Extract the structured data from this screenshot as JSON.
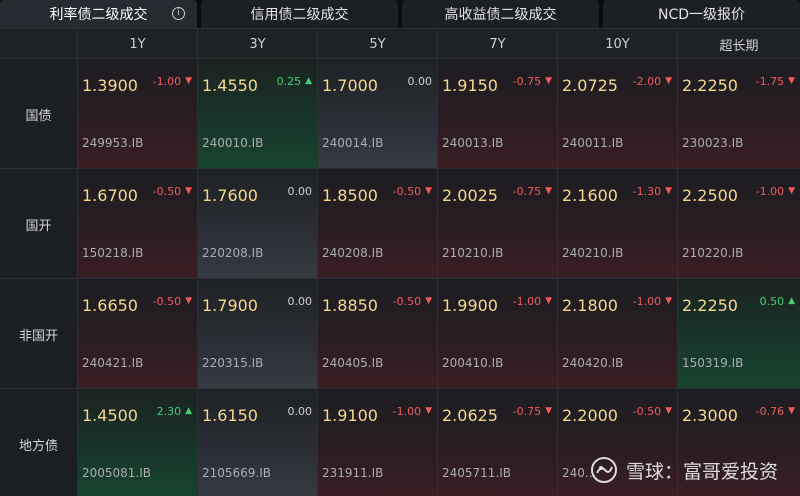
{
  "tabs": [
    {
      "label": "利率债二级成交",
      "active": true,
      "icon": "info-icon"
    },
    {
      "label": "信用债二级成交",
      "active": false
    },
    {
      "label": "高收益债二级成交",
      "active": false
    },
    {
      "label": "NCD一级报价",
      "active": false
    }
  ],
  "info_icon_glyph": "i",
  "columns": [
    "1Y",
    "3Y",
    "5Y",
    "7Y",
    "10Y",
    "超长期"
  ],
  "rows": [
    {
      "label": "国债",
      "cells": [
        {
          "price": "1.3900",
          "change": "-1.00",
          "direction": "down",
          "code": "249953.IB"
        },
        {
          "price": "1.4550",
          "change": "0.25",
          "direction": "up",
          "code": "240010.IB"
        },
        {
          "price": "1.7000",
          "change": "0.00",
          "direction": "flat",
          "code": "240014.IB"
        },
        {
          "price": "1.9150",
          "change": "-0.75",
          "direction": "down",
          "code": "240013.IB"
        },
        {
          "price": "2.0725",
          "change": "-2.00",
          "direction": "down",
          "code": "240011.IB"
        },
        {
          "price": "2.2250",
          "change": "-1.75",
          "direction": "down",
          "code": "230023.IB"
        }
      ]
    },
    {
      "label": "国开",
      "cells": [
        {
          "price": "1.6700",
          "change": "-0.50",
          "direction": "down",
          "code": "150218.IB"
        },
        {
          "price": "1.7600",
          "change": "0.00",
          "direction": "flat",
          "code": "220208.IB"
        },
        {
          "price": "1.8500",
          "change": "-0.50",
          "direction": "down",
          "code": "240208.IB"
        },
        {
          "price": "2.0025",
          "change": "-0.75",
          "direction": "down",
          "code": "210210.IB"
        },
        {
          "price": "2.1600",
          "change": "-1.30",
          "direction": "down",
          "code": "240210.IB"
        },
        {
          "price": "2.2500",
          "change": "-1.00",
          "direction": "down",
          "code": "210220.IB"
        }
      ]
    },
    {
      "label": "非国开",
      "cells": [
        {
          "price": "1.6650",
          "change": "-0.50",
          "direction": "down",
          "code": "240421.IB"
        },
        {
          "price": "1.7900",
          "change": "0.00",
          "direction": "flat",
          "code": "220315.IB"
        },
        {
          "price": "1.8850",
          "change": "-0.50",
          "direction": "down",
          "code": "240405.IB"
        },
        {
          "price": "1.9900",
          "change": "-1.00",
          "direction": "down",
          "code": "200410.IB"
        },
        {
          "price": "2.1800",
          "change": "-1.00",
          "direction": "down",
          "code": "240420.IB"
        },
        {
          "price": "2.2250",
          "change": "0.50",
          "direction": "up",
          "code": "150319.IB"
        }
      ]
    },
    {
      "label": "地方债",
      "cells": [
        {
          "price": "1.4500",
          "change": "2.30",
          "direction": "up",
          "code": "2005081.IB"
        },
        {
          "price": "1.6150",
          "change": "0.00",
          "direction": "flat",
          "code": "2105669.IB"
        },
        {
          "price": "1.9100",
          "change": "-1.00",
          "direction": "down",
          "code": "231911.IB"
        },
        {
          "price": "2.0625",
          "change": "-0.75",
          "direction": "down",
          "code": "2405711.IB"
        },
        {
          "price": "2.2000",
          "change": "-0.50",
          "direction": "down",
          "code": "240..."
        },
        {
          "price": "2.3000",
          "change": "-0.76",
          "direction": "down",
          "code": ""
        }
      ]
    }
  ],
  "watermark": {
    "text": "雪球：富哥爱投资",
    "icon": "snowball-logo-icon"
  },
  "colors": {
    "price": "#f5d98a",
    "down": "#f05a5a",
    "up": "#3fcf6e",
    "flat": "#cfcfcf",
    "background": "#15171b"
  }
}
